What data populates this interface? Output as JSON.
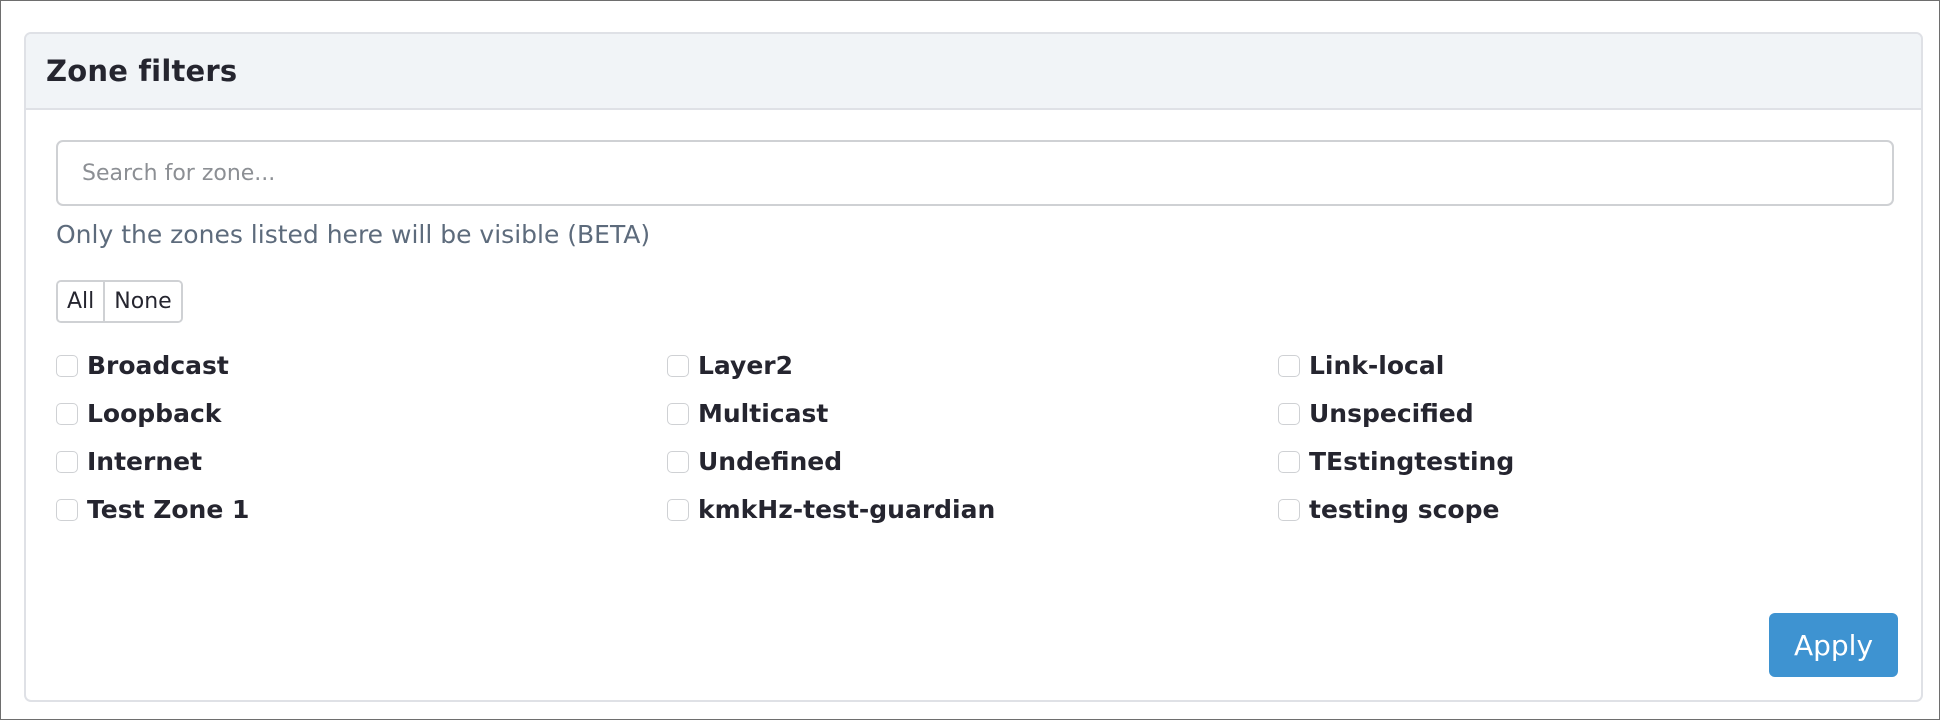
{
  "panel": {
    "title": "Zone filters"
  },
  "search": {
    "placeholder": "Search for zone...",
    "value": ""
  },
  "help_text": "Only the zones listed here will be visible (BETA)",
  "select_buttons": {
    "all_label": "All",
    "none_label": "None"
  },
  "zones": [
    {
      "label": "Broadcast",
      "checked": false
    },
    {
      "label": "Layer2",
      "checked": false
    },
    {
      "label": "Link-local",
      "checked": false
    },
    {
      "label": "Loopback",
      "checked": false
    },
    {
      "label": "Multicast",
      "checked": false
    },
    {
      "label": "Unspecified",
      "checked": false
    },
    {
      "label": "Internet",
      "checked": false
    },
    {
      "label": "Undefined",
      "checked": false
    },
    {
      "label": "TEstingtesting",
      "checked": false
    },
    {
      "label": "Test Zone 1",
      "checked": false
    },
    {
      "label": "kmkHz-test-guardian",
      "checked": false
    },
    {
      "label": "testing scope",
      "checked": false
    }
  ],
  "apply_button": {
    "label": "Apply",
    "color": "#3e93d1"
  }
}
